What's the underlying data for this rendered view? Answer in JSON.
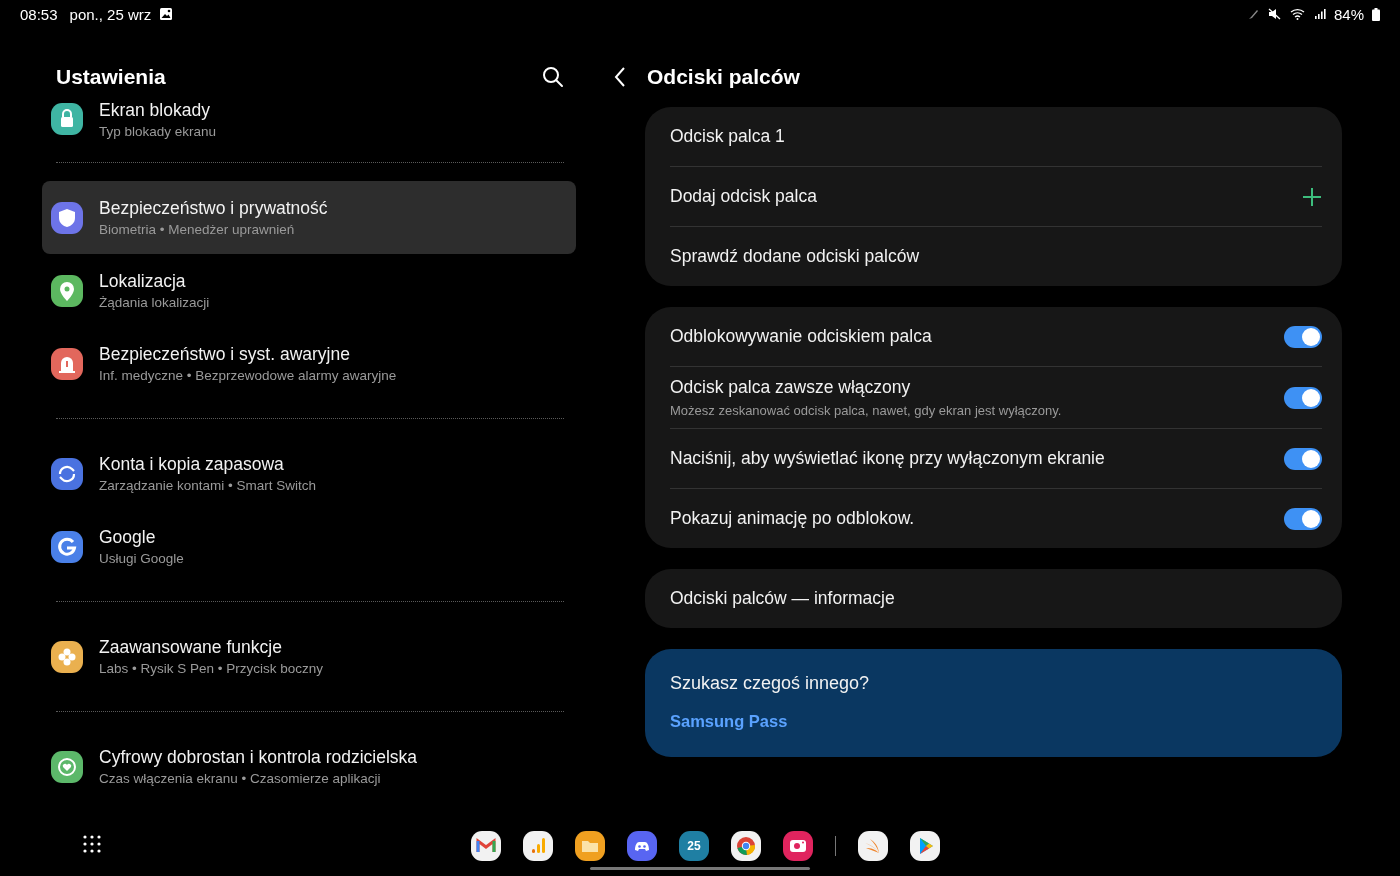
{
  "status_bar": {
    "time": "08:53",
    "date": "pon., 25 wrz",
    "battery": "84%"
  },
  "settings": {
    "title": "Ustawienia",
    "groups": [
      {
        "items": [
          {
            "title": "Ekran blokady",
            "subtitle": "Typ blokady ekranu",
            "color": "#3fb5a3",
            "selected": false
          }
        ]
      },
      {
        "items": [
          {
            "title": "Bezpieczeństwo i prywatność",
            "subtitle": "Biometria • Menedżer uprawnień",
            "color": "#6d74e8",
            "selected": true
          },
          {
            "title": "Lokalizacja",
            "subtitle": "Żądania lokalizacji",
            "color": "#5cb860",
            "selected": false
          },
          {
            "title": "Bezpieczeństwo i syst. awaryjne",
            "subtitle": "Inf. medyczne • Bezprzewodowe alarmy awaryjne",
            "color": "#e2675c",
            "selected": false
          }
        ]
      },
      {
        "items": [
          {
            "title": "Konta i kopia zapasowa",
            "subtitle": "Zarządzanie kontami • Smart Switch",
            "color": "#4a72e0",
            "selected": false
          },
          {
            "title": "Google",
            "subtitle": "Usługi Google",
            "color": "#4a80e8",
            "selected": false
          }
        ]
      },
      {
        "items": [
          {
            "title": "Zaawansowane funkcje",
            "subtitle": "Labs • Rysik S Pen • Przycisk boczny",
            "color": "#eab04f",
            "selected": false
          }
        ]
      },
      {
        "items": [
          {
            "title": "Cyfrowy dobrostan i kontrola rodzicielska",
            "subtitle": "Czas włączenia ekranu • Czasomierze aplikacji",
            "color": "#5cb86a",
            "selected": false
          }
        ]
      }
    ]
  },
  "detail": {
    "title": "Odciski palców",
    "cards": [
      {
        "rows": [
          {
            "kind": "text",
            "label": "Odcisk palca 1"
          },
          {
            "kind": "add",
            "label": "Dodaj odcisk palca"
          },
          {
            "kind": "text",
            "label": "Sprawdź dodane odciski palców"
          }
        ]
      },
      {
        "rows": [
          {
            "kind": "toggle",
            "label": "Odblokowywanie odciskiem palca",
            "on": true
          },
          {
            "kind": "toggle",
            "label": "Odcisk palca zawsze włączony",
            "description": "Możesz zeskanować odcisk palca, nawet, gdy ekran jest wyłączony.",
            "on": true
          },
          {
            "kind": "toggle",
            "label": "Naciśnij, aby wyświetlać ikonę przy wyłączonym ekranie",
            "on": true
          },
          {
            "kind": "toggle",
            "label": "Pokazuj animację po odblokow.",
            "on": true
          }
        ]
      },
      {
        "rows": [
          {
            "kind": "text",
            "label": "Odciski palców — informacje"
          }
        ]
      }
    ],
    "suggestion": {
      "heading": "Szukasz czegoś innego?",
      "link": "Samsung Pass"
    }
  },
  "dock": {
    "calendar_day": "25"
  }
}
